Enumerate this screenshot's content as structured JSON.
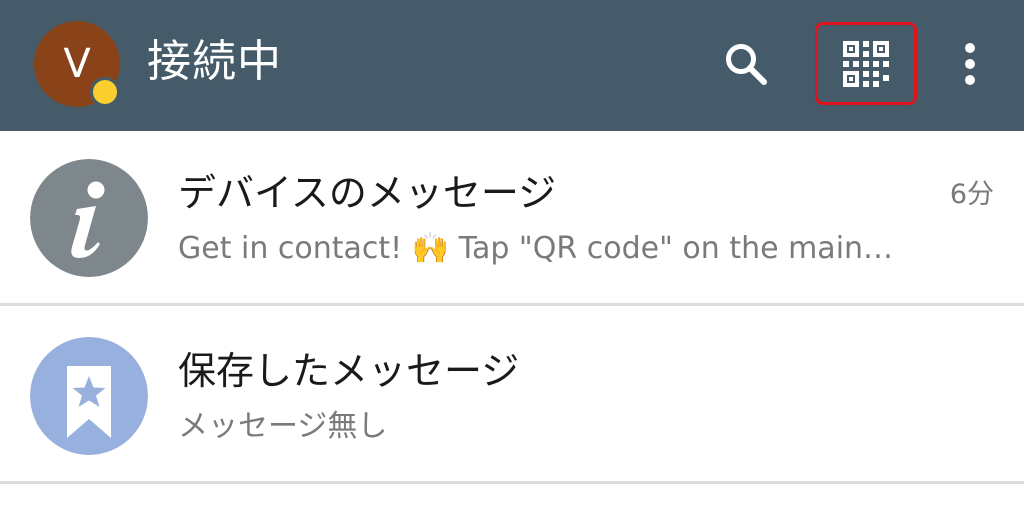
{
  "header": {
    "account_initial": "V",
    "title": "接続中",
    "icons": {
      "search": "search-icon",
      "qr": "qr-code-icon",
      "more": "more-vertical-icon"
    },
    "colors": {
      "bar": "#465b69",
      "avatar": "#8a4318",
      "status_dot": "#fbcf2f",
      "qr_highlight": "#e0131c"
    }
  },
  "chats": [
    {
      "title": "デバイスのメッセージ",
      "preview_before": "Get in contact! ",
      "preview_emoji": "🙌",
      "preview_after": " Tap \"QR code\" on the main…",
      "time": "6分",
      "avatar_icon": "info-icon",
      "avatar_color": "#7e878c"
    },
    {
      "title": "保存したメッセージ",
      "preview": "メッセージ無し",
      "avatar_icon": "bookmark-star-icon",
      "avatar_color": "#97b0dd"
    }
  ]
}
